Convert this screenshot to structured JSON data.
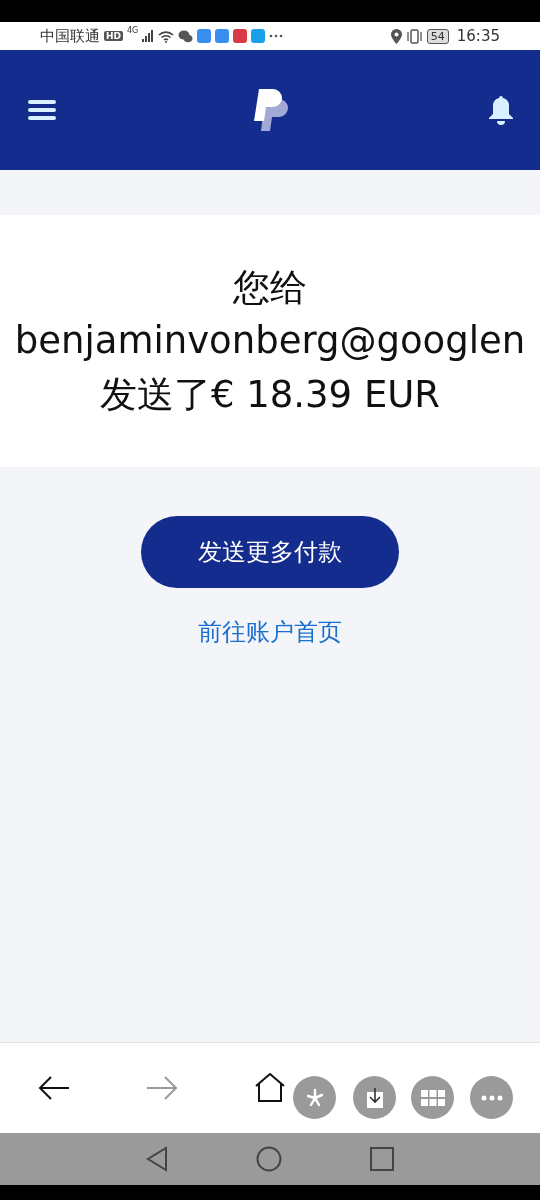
{
  "status_bar": {
    "carrier": "中国联通",
    "hd_badge": "HD",
    "network": "4G",
    "battery": "54",
    "time": "16:35"
  },
  "message": {
    "lines": [
      "您给",
      "benjaminvonberg@googlen",
      "发送了€ 18.39 EUR"
    ]
  },
  "primary_button": "发送更多付款",
  "link": "前往账户首页",
  "browser_toolbar": {
    "back_disabled": false,
    "forward_disabled": true
  }
}
